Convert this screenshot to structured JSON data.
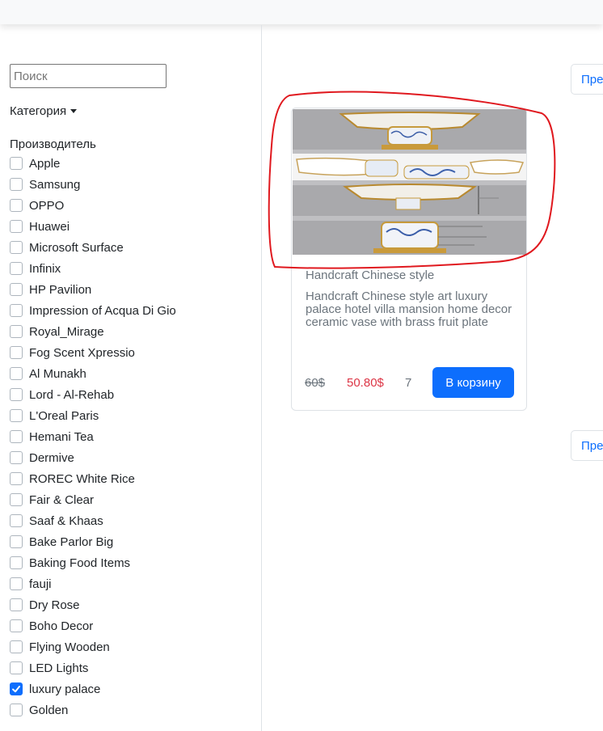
{
  "sidebar": {
    "search_placeholder": "Поиск",
    "category_label": "Категория",
    "maker_title": "Производитель",
    "makers": [
      {
        "label": "Apple",
        "checked": false
      },
      {
        "label": "Samsung",
        "checked": false
      },
      {
        "label": "OPPO",
        "checked": false
      },
      {
        "label": "Huawei",
        "checked": false
      },
      {
        "label": "Microsoft Surface",
        "checked": false
      },
      {
        "label": "Infinix",
        "checked": false
      },
      {
        "label": "HP Pavilion",
        "checked": false
      },
      {
        "label": "Impression of Acqua Di Gio",
        "checked": false
      },
      {
        "label": "Royal_Mirage",
        "checked": false
      },
      {
        "label": "Fog Scent Xpressio",
        "checked": false
      },
      {
        "label": "Al Munakh",
        "checked": false
      },
      {
        "label": "Lord - Al-Rehab",
        "checked": false
      },
      {
        "label": "L'Oreal Paris",
        "checked": false
      },
      {
        "label": "Hemani Tea",
        "checked": false
      },
      {
        "label": "Dermive",
        "checked": false
      },
      {
        "label": "ROREC White Rice",
        "checked": false
      },
      {
        "label": "Fair & Clear",
        "checked": false
      },
      {
        "label": "Saaf & Khaas",
        "checked": false
      },
      {
        "label": "Bake Parlor Big",
        "checked": false
      },
      {
        "label": "Baking Food Items",
        "checked": false
      },
      {
        "label": "fauji",
        "checked": false
      },
      {
        "label": "Dry Rose",
        "checked": false
      },
      {
        "label": "Boho Decor",
        "checked": false
      },
      {
        "label": "Flying Wooden",
        "checked": false
      },
      {
        "label": "LED Lights",
        "checked": false
      },
      {
        "label": "luxury palace",
        "checked": true
      },
      {
        "label": "Golden",
        "checked": false
      }
    ]
  },
  "pagination": {
    "top_label": "Пре",
    "bottom_label": "Пре"
  },
  "product": {
    "name": "Handcraft Chinese style",
    "description": "Handcraft Chinese style art luxury palace hotel villa mansion home decor ceramic vase with brass fruit plate",
    "old_price": "60$",
    "new_price": "50.80$",
    "quantity": "7",
    "cart_button": "В корзину",
    "image_icon": "product-photo"
  },
  "colors": {
    "accent": "#0d6efd",
    "sale_price": "#dc3545",
    "annotation": "#e0191f"
  }
}
